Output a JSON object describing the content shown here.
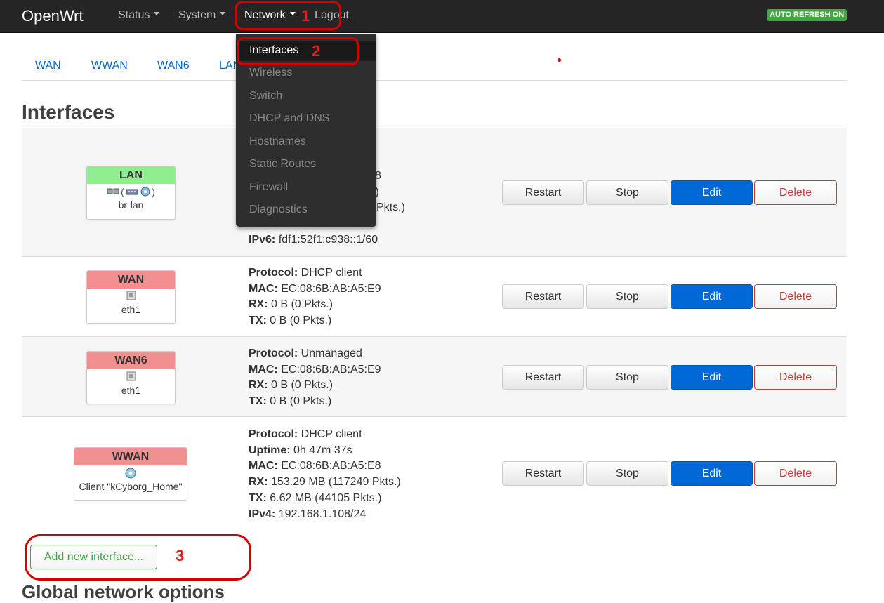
{
  "navbar": {
    "brand": "OpenWrt",
    "menus": [
      "Status",
      "System",
      "Network",
      "Logout"
    ],
    "auto_refresh": "AUTO REFRESH ON"
  },
  "network_dropdown": {
    "items": [
      "Interfaces",
      "Wireless",
      "Switch",
      "DHCP and DNS",
      "Hostnames",
      "Static Routes",
      "Firewall",
      "Diagnostics"
    ],
    "active": "Interfaces"
  },
  "tabs": [
    "WAN",
    "WWAN",
    "WAN6",
    "LAN"
  ],
  "page_title": "Interfaces",
  "interfaces": [
    {
      "name": "LAN",
      "device": "br-lan",
      "status_color": "#90ee90",
      "status": [
        {
          "label": "",
          "value": "8"
        },
        {
          "label": "",
          "value": ".)"
        },
        {
          "label": "",
          "value": "Pkts.)"
        },
        {
          "label": "IPv4:",
          "value": "192.168.100.1/24"
        },
        {
          "label": "IPv6:",
          "value": "fdf1:52f1:c938::1/60"
        }
      ]
    },
    {
      "name": "WAN",
      "device": "eth1",
      "status_color": "#f09090",
      "status": [
        {
          "label": "Protocol:",
          "value": "DHCP client"
        },
        {
          "label": "MAC:",
          "value": "EC:08:6B:AB:A5:E9"
        },
        {
          "label": "RX:",
          "value": "0 B (0 Pkts.)"
        },
        {
          "label": "TX:",
          "value": "0 B (0 Pkts.)"
        }
      ]
    },
    {
      "name": "WAN6",
      "device": "eth1",
      "status_color": "#f09090",
      "status": [
        {
          "label": "Protocol:",
          "value": "Unmanaged"
        },
        {
          "label": "MAC:",
          "value": "EC:08:6B:AB:A5:E9"
        },
        {
          "label": "RX:",
          "value": "0 B (0 Pkts.)"
        },
        {
          "label": "TX:",
          "value": "0 B (0 Pkts.)"
        }
      ]
    },
    {
      "name": "WWAN",
      "device": "Client \"kCyborg_Home\"",
      "status_color": "#f09090",
      "status": [
        {
          "label": "Protocol:",
          "value": "DHCP client"
        },
        {
          "label": "Uptime:",
          "value": "0h 47m 37s"
        },
        {
          "label": "MAC:",
          "value": "EC:08:6B:AB:A5:E8"
        },
        {
          "label": "RX:",
          "value": "153.29 MB (117249 Pkts.)"
        },
        {
          "label": "TX:",
          "value": "6.62 MB (44105 Pkts.)"
        },
        {
          "label": "IPv4:",
          "value": "192.168.1.108/24"
        }
      ]
    }
  ],
  "buttons": {
    "restart": "Restart",
    "stop": "Stop",
    "edit": "Edit",
    "delete": "Delete"
  },
  "add_interface": "Add new interface...",
  "bottom_heading": "Global network options",
  "annotations": [
    "1",
    "2",
    "3"
  ]
}
